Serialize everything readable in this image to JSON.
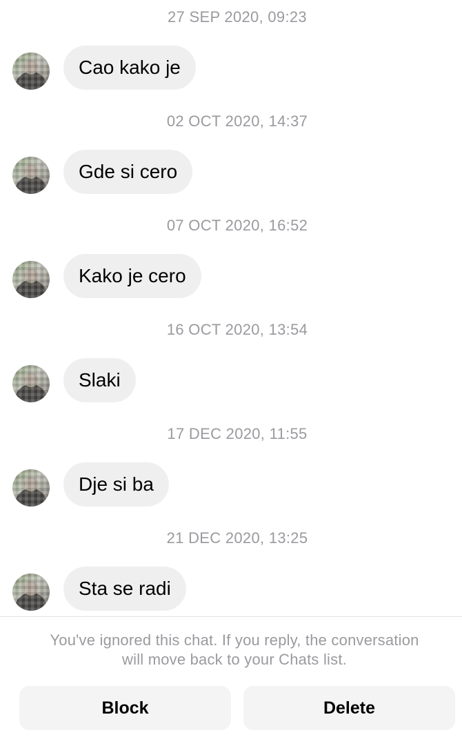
{
  "conversation": {
    "messages": [
      {
        "timestamp": "27 SEP 2020, 09:23",
        "text": "Cao kako je"
      },
      {
        "timestamp": "02 OCT 2020, 14:37",
        "text": "Gde si cero"
      },
      {
        "timestamp": "07 OCT 2020, 16:52",
        "text": "Kako je cero"
      },
      {
        "timestamp": "16 OCT 2020, 13:54",
        "text": "Slaki"
      },
      {
        "timestamp": "17 DEC 2020, 11:55",
        "text": "Dje si ba"
      },
      {
        "timestamp": "21 DEC 2020, 13:25",
        "text": "Sta se radi"
      }
    ]
  },
  "footer": {
    "notice_line1": "You've ignored this chat. If you reply, the conversation",
    "notice_line2": "will move back to your Chats list.",
    "block_label": "Block",
    "delete_label": "Delete"
  },
  "colors": {
    "bubble_background": "#efefef",
    "timestamp_text": "#9a9a9f",
    "button_background": "#f4f4f4"
  }
}
